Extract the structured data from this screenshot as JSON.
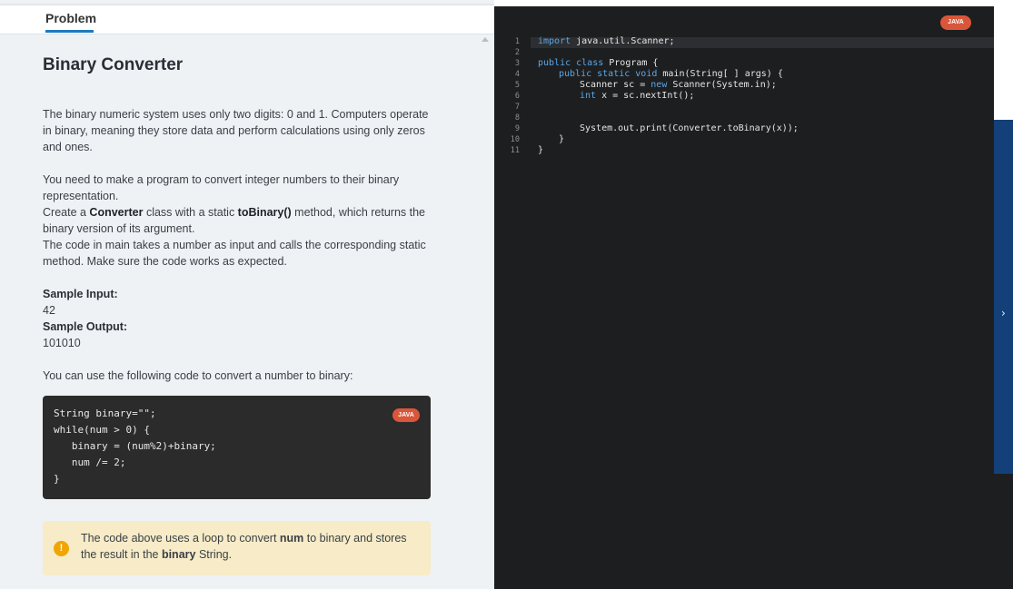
{
  "tabs": {
    "active": "Problem"
  },
  "problem": {
    "title": "Binary Converter",
    "intro": "The binary numeric system uses only two digits: 0 and 1. Computers operate in binary, meaning they store data and perform calculations using only zeros and ones.",
    "task_line1": "You need to make a program to convert integer numbers to their binary representation.",
    "task_line2_prefix": "Create a ",
    "task_line2_class": "Converter",
    "task_line2_mid": " class with a static ",
    "task_line2_method": "toBinary()",
    "task_line2_suffix": " method, which returns the binary version of its argument.",
    "task_line3": "The code in main takes a number as input and calls the corresponding static method. Make sure the code works as expected.",
    "sample_input_label": "Sample Input:",
    "sample_input": "42",
    "sample_output_label": "Sample Output:",
    "sample_output": "101010",
    "hint_intro": "You can use the following code to convert a number to binary:",
    "code_badge": "JAVA",
    "code_lines": [
      "String binary=\"\";",
      "while(num > 0) {",
      "   binary = (num%2)+binary;",
      "   num /= 2;",
      "}"
    ],
    "note_prefix": "The code above uses a loop to convert ",
    "note_num": "num",
    "note_mid": " to binary and stores the result in the ",
    "note_binary": "binary",
    "note_suffix": " String.",
    "note_icon": "!"
  },
  "editor": {
    "language_badge": "JAVA",
    "line_numbers": [
      "1",
      "2",
      "3",
      "4",
      "5",
      "6",
      "7",
      "8",
      "9",
      "10",
      "11"
    ],
    "lines": {
      "l1_kw": "import",
      "l1_rest": " java.util.Scanner;",
      "l3_kw": "public class",
      "l3_rest": " Program {",
      "l4_kw": "public static void",
      "l4_rest": " main(String[ ] args) {",
      "l5_a": "Scanner sc = ",
      "l5_kw": "new",
      "l5_b": " Scanner(System.in);",
      "l6_kw": "int",
      "l6_rest": " x = sc.nextInt();",
      "l9": "System.out.print(Converter.toBinary(x));",
      "l10": "}",
      "l11": "}"
    }
  },
  "right_strip": {
    "chevron": "›"
  }
}
